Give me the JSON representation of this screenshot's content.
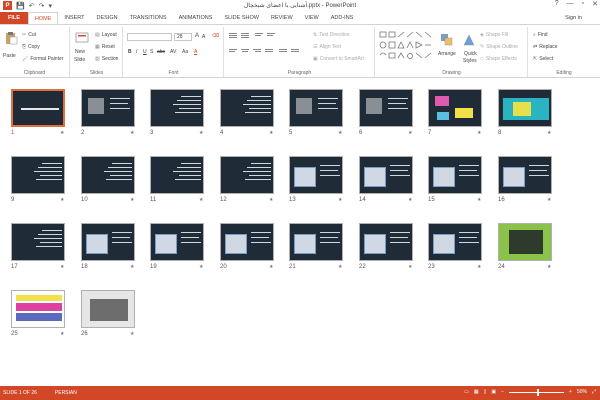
{
  "window": {
    "title": "آشنایی با اعضای شیخچال.pptx - PowerPoint",
    "controls": [
      "?",
      "—",
      "▫",
      "✕"
    ],
    "sign_in": "Sign in"
  },
  "quick_access": {
    "app_icon": "P",
    "save": "💾",
    "undo": "↶",
    "redo": "↷",
    "more": "▾"
  },
  "tabs": [
    "FILE",
    "HOME",
    "INSERT",
    "DESIGN",
    "TRANSITIONS",
    "ANIMATIONS",
    "SLIDE SHOW",
    "REVIEW",
    "VIEW",
    "ADD-INS"
  ],
  "active_tab": "HOME",
  "ribbon": {
    "clipboard": {
      "label": "Clipboard",
      "paste": "Paste",
      "cut": "Cut",
      "copy": "Copy",
      "format_painter": "Format Painter"
    },
    "slides": {
      "label": "Slides",
      "new_slide": "New",
      "new_slide2": "Slide",
      "layout": "Layout",
      "reset": "Reset",
      "section": "Section"
    },
    "font": {
      "label": "Font",
      "size": "28",
      "bold": "B",
      "italic": "I",
      "underline": "U",
      "strike": "S",
      "shadow": "abc",
      "spacing": "AV",
      "case": "Aa",
      "color": "A",
      "grow": "A",
      "shrink": "A"
    },
    "paragraph": {
      "label": "Paragraph",
      "text_direction": "Text Direction",
      "align_text": "Align Text",
      "smartart": "Convert to SmartArt"
    },
    "drawing": {
      "label": "Drawing",
      "arrange": "Arrange",
      "quick_styles": "Quick",
      "quick_styles2": "Styles",
      "shape_fill": "Shape Fill",
      "shape_outline": "Shape Outline",
      "shape_effects": "Shape Effects"
    },
    "editing": {
      "label": "Editing",
      "find": "Find",
      "replace": "Replace",
      "select": "Select"
    }
  },
  "slides": [
    {
      "n": "1"
    },
    {
      "n": "2"
    },
    {
      "n": "3"
    },
    {
      "n": "4"
    },
    {
      "n": "5"
    },
    {
      "n": "6"
    },
    {
      "n": "7"
    },
    {
      "n": "8"
    },
    {
      "n": "9"
    },
    {
      "n": "10"
    },
    {
      "n": "11"
    },
    {
      "n": "12"
    },
    {
      "n": "13"
    },
    {
      "n": "14"
    },
    {
      "n": "15"
    },
    {
      "n": "16"
    },
    {
      "n": "17"
    },
    {
      "n": "18"
    },
    {
      "n": "19"
    },
    {
      "n": "20"
    },
    {
      "n": "21"
    },
    {
      "n": "22"
    },
    {
      "n": "23"
    },
    {
      "n": "24"
    },
    {
      "n": "25"
    },
    {
      "n": "26"
    }
  ],
  "status": {
    "slide_info": "SLIDE 1 OF 26",
    "language": "PERSIAN",
    "zoom": "50%"
  },
  "colors": {
    "accent": "#d24726",
    "slide_bg": "#1f2b36"
  }
}
